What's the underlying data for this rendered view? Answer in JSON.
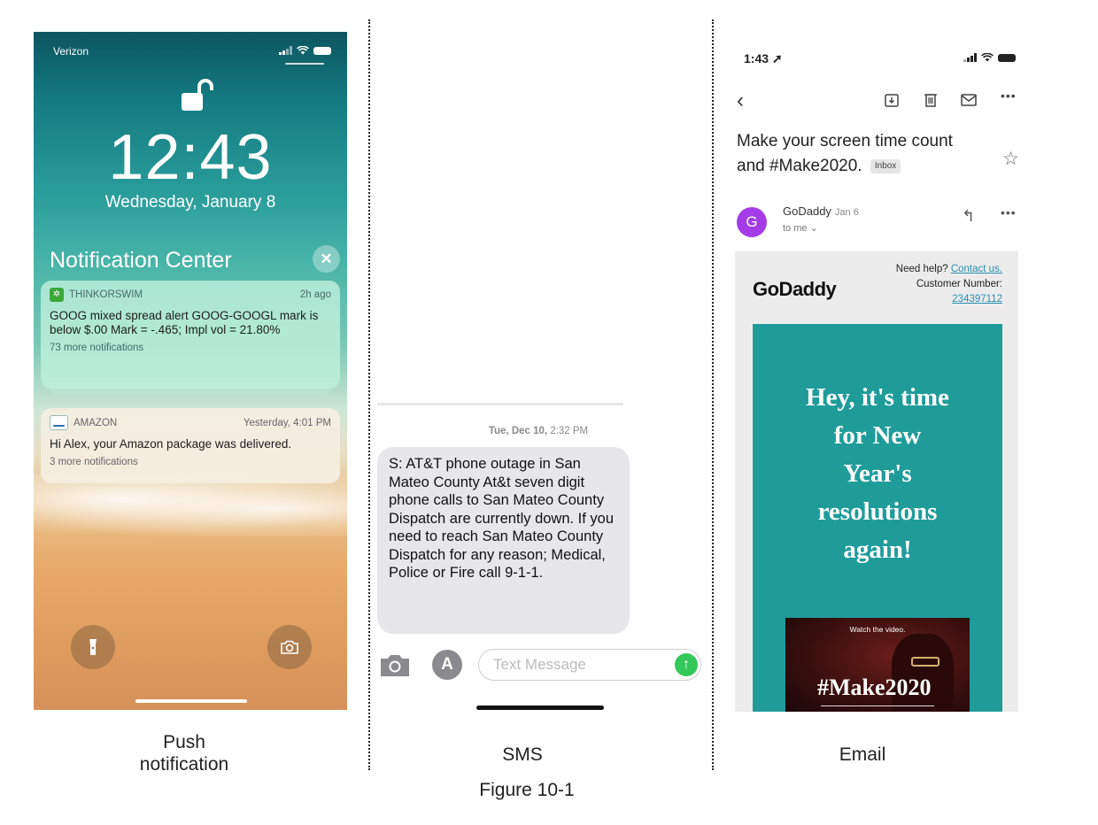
{
  "push": {
    "carrier": "Verizon",
    "time": "12:43",
    "date": "Wednesday, January 8",
    "center_title": "Notification Center",
    "notifications": [
      {
        "app": "THINKORSWIM",
        "time": "2h ago",
        "body": "GOOG mixed spread alert GOOG-GOOGL mark is below $.00 Mark = -.465; Impl vol = 21.80%",
        "more": "73 more notifications"
      },
      {
        "app": "AMAZON",
        "time": "Yesterday, 4:01 PM",
        "body": "Hi Alex, your Amazon package was delivered.",
        "more": "3 more notifications"
      }
    ],
    "caption_line1": "Push",
    "caption_line2": "notification"
  },
  "sms": {
    "stamp_day": "Tue, Dec 10,",
    "stamp_time": "2:32 PM",
    "message": "S: AT&T phone outage in San Mateo County At&t seven digit phone calls to San Mateo County Dispatch are currently down.  If you need to reach San Mateo County Dispatch for any reason; Medical, Police or Fire call 9-1-1.",
    "input_placeholder": "Text Message",
    "caption": "SMS"
  },
  "email": {
    "status_time": "1:43",
    "subject": "Make your screen time count and #Make2020.",
    "badge": "Inbox",
    "avatar_letter": "G",
    "sender": "GoDaddy",
    "date": "Jan 6",
    "to": "to me",
    "logo": "GoDaddy",
    "help_text": "Need help?",
    "contact_link": "Contact us.",
    "customer_label": "Customer Number:",
    "customer_number": "234397112",
    "hero_line1": "Hey, it's time",
    "hero_line2": "for New",
    "hero_line3": "Year's",
    "hero_line4": "resolutions",
    "hero_line5": "again!",
    "video_label": "Watch the video.",
    "video_tag": "#Make2020",
    "caption": "Email"
  },
  "figure_caption": "Figure 10-1",
  "colors": {
    "send_green": "#34c759",
    "gmail_avatar": "#a33ce6",
    "godaddy_teal": "#1f9c9a"
  }
}
